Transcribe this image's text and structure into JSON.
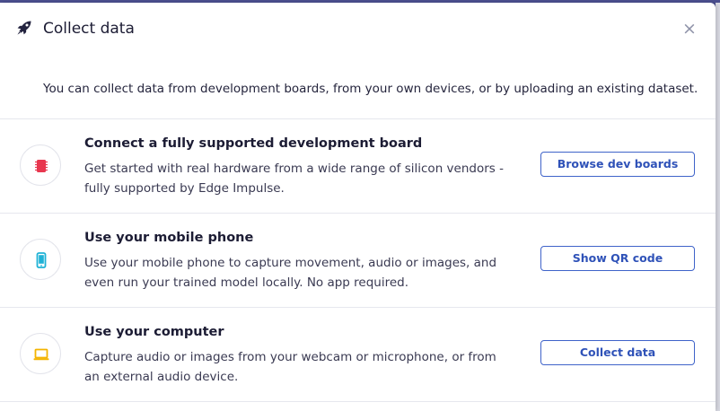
{
  "dialog": {
    "title": "Collect data",
    "close_label": "×",
    "intro": "You can collect data from development boards, from your own devices, or by uploading an existing dataset."
  },
  "options": [
    {
      "title": "Connect a fully supported development board",
      "description": "Get started with real hardware from a wide range of silicon vendors - fully supported by Edge Impulse.",
      "button_label": "Browse dev boards",
      "icon": "microchip-icon",
      "icon_color": "#e8374f"
    },
    {
      "title": "Use your mobile phone",
      "description": "Use your mobile phone to capture movement, audio or images, and even run your trained model locally. No app required.",
      "button_label": "Show QR code",
      "icon": "mobile-phone-icon",
      "icon_color": "#1fb2d6"
    },
    {
      "title": "Use your computer",
      "description": "Capture audio or images from your webcam or microphone, or from an external audio device.",
      "button_label": "Collect data",
      "icon": "laptop-icon",
      "icon_color": "#f4b400"
    }
  ],
  "colors": {
    "accent": "#3f63c9",
    "title_text": "#1c1c34"
  }
}
